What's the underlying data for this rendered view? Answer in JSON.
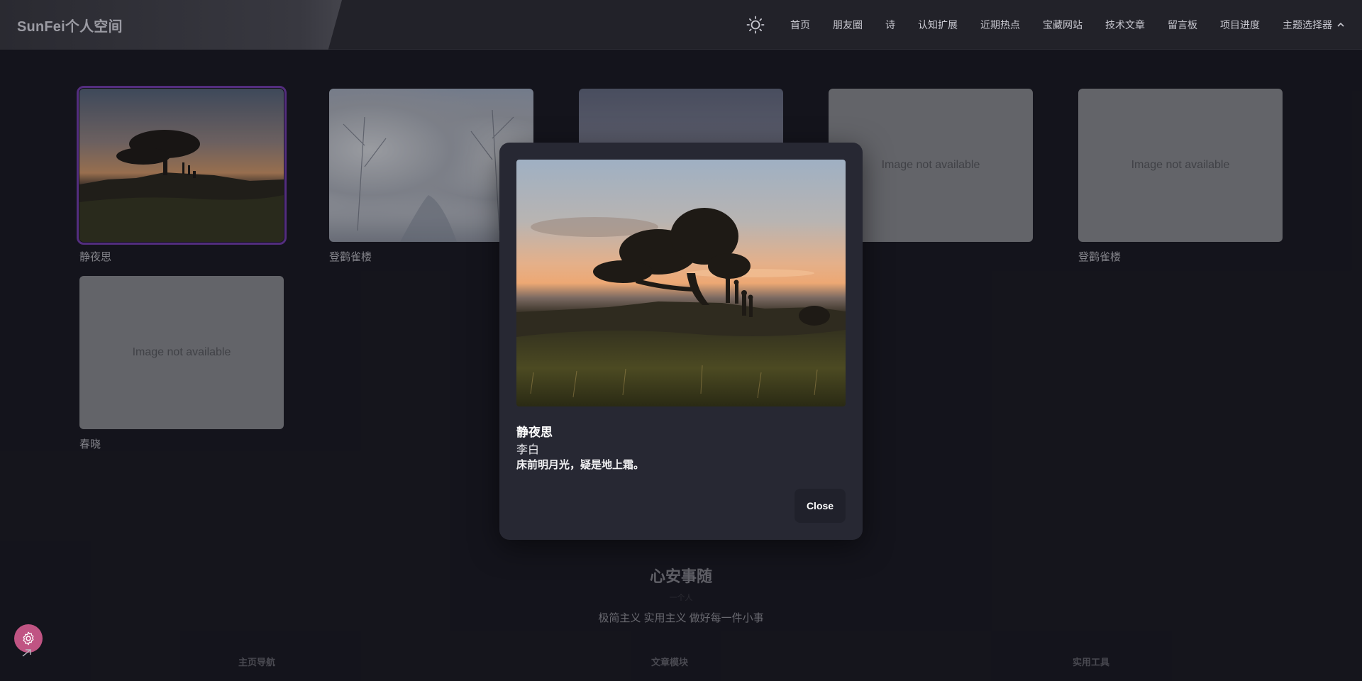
{
  "header": {
    "brand": "SunFei个人空间",
    "theme_icon": "sun-icon",
    "nav": [
      {
        "label": "首页"
      },
      {
        "label": "朋友圈"
      },
      {
        "label": "诗"
      },
      {
        "label": "认知扩展"
      },
      {
        "label": "近期热点"
      },
      {
        "label": "宝藏网站"
      },
      {
        "label": "技术文章"
      },
      {
        "label": "留言板"
      },
      {
        "label": "项目进度"
      },
      {
        "label": "主题选择器",
        "icon": "chevron-up-icon"
      }
    ]
  },
  "gallery": {
    "cards": [
      {
        "caption": "静夜思",
        "image": "sunset-tree",
        "selected": true
      },
      {
        "caption": "登鹳雀楼",
        "image": "snow-forest"
      },
      {
        "caption": "",
        "image": "dusk-sky"
      },
      {
        "caption": "",
        "placeholder": "Image not available"
      },
      {
        "caption": "登鹳雀楼",
        "placeholder": "Image not available"
      },
      {
        "caption": "春晓",
        "placeholder": "Image not available"
      }
    ]
  },
  "modal": {
    "title": "静夜思",
    "author": "李白",
    "line": "床前明月光，疑是地上霜。",
    "close_label": "Close"
  },
  "footer": {
    "title": "心安事随",
    "subtitle": "一个人",
    "slogan": "极简主义 实用主义 做好每一件小事",
    "columns": [
      "主页导航",
      "文章模块",
      "实用工具"
    ]
  },
  "colors": {
    "accent_selected": "#7a3fb8",
    "fab": "#c05483",
    "background": "#1a1a22",
    "modal": "#272833"
  },
  "fab": {
    "icon": "gear-icon",
    "arrow_icon": "arrow-right-icon"
  }
}
